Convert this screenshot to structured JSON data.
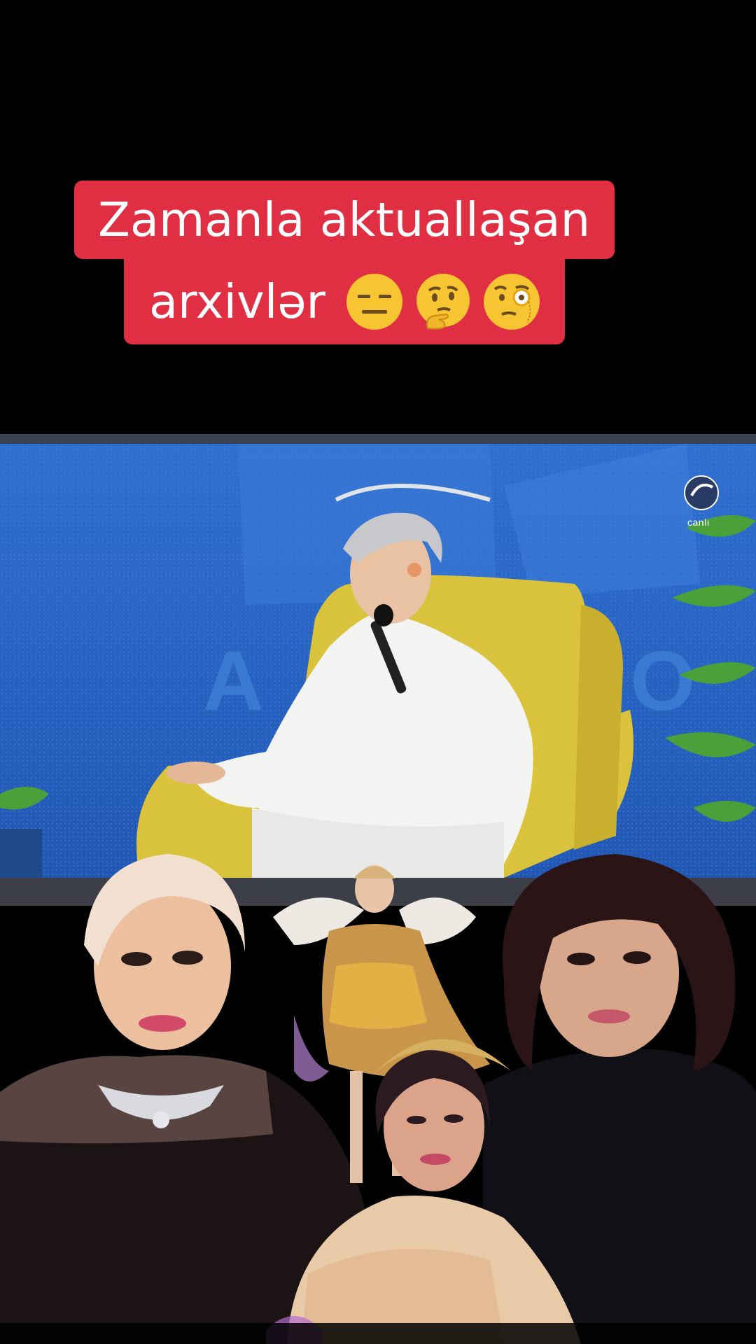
{
  "caption": {
    "line1": "Zamanla aktuallaşan",
    "line2": "arxivlər",
    "emojis": [
      "expressionless-face",
      "thinking-face",
      "face-with-monocle"
    ],
    "background_color": "#e02f43",
    "text_color": "#ffffff"
  },
  "video": {
    "channel_logo_text": "canlı"
  }
}
